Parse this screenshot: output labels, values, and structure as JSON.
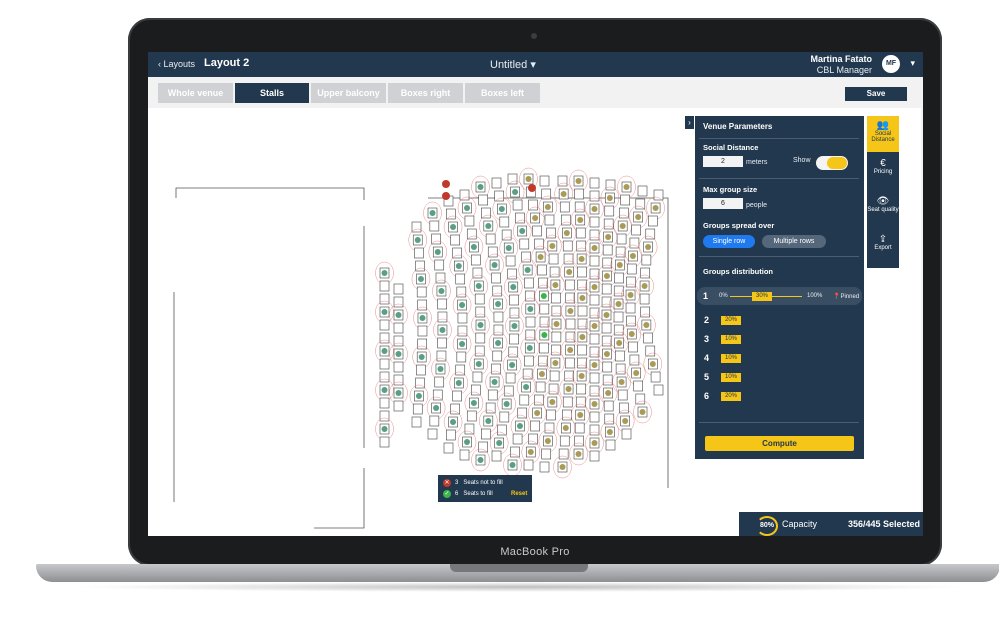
{
  "device": {
    "brand": "MacBook Pro"
  },
  "header": {
    "back_label": "‹ Layouts",
    "layout_name": "Layout 2",
    "doc_title": "Untitled ▾",
    "user_name": "Martina Fatato",
    "user_role": "CBL Manager",
    "user_initials": "MF"
  },
  "tabs": [
    {
      "label": "Whole venue",
      "active": false
    },
    {
      "label": "Stalls",
      "active": true
    },
    {
      "label": "Upper balcony",
      "active": false
    },
    {
      "label": "Boxes right",
      "active": false
    },
    {
      "label": "Boxes left",
      "active": false
    }
  ],
  "toolbar": {
    "save_label": "Save"
  },
  "panel": {
    "title": "Venue Parameters",
    "social_distance": {
      "label": "Social Distance",
      "value": "2",
      "unit": "meters",
      "show_label": "Show",
      "show_on": true
    },
    "max_group": {
      "label": "Max group size",
      "value": "6",
      "unit": "people"
    },
    "spread": {
      "label": "Groups spread over",
      "option_single": "Single row",
      "option_multiple": "Multiple rows",
      "selected": "Single row"
    },
    "distribution": {
      "label": "Groups distribution",
      "row1": {
        "num": "1",
        "min": "0%",
        "value": "30%",
        "max": "100%",
        "pinned": "📍Pinned"
      },
      "rows": [
        {
          "num": "2",
          "value": "20%"
        },
        {
          "num": "3",
          "value": "10%"
        },
        {
          "num": "4",
          "value": "10%"
        },
        {
          "num": "5",
          "value": "10%"
        },
        {
          "num": "6",
          "value": "20%"
        }
      ]
    },
    "compute_label": "Compute"
  },
  "tools": [
    {
      "label": "Social Distance",
      "icon": "people-icon",
      "active": true
    },
    {
      "label": "Pricing",
      "icon": "euro-icon",
      "active": false
    },
    {
      "label": "Seat quality",
      "icon": "eye-icon",
      "active": false
    },
    {
      "label": "Export",
      "icon": "export-icon",
      "active": false
    }
  ],
  "legend": {
    "not_fill_count": "3",
    "not_fill_label": "Seats not to fill",
    "fill_count": "6",
    "fill_label": "Seats to fill",
    "reset_label": "Reset"
  },
  "capacity": {
    "percent": "80%",
    "label": "Capacity",
    "selected": "356/445 Selected"
  },
  "colors": {
    "navy": "#22384e",
    "accent": "#f5c518",
    "blue": "#1f7af0",
    "seat_green": "#5a9e84",
    "seat_olive": "#a99a57",
    "selected_green": "#39b54a",
    "blocked_red": "#c0392b"
  }
}
